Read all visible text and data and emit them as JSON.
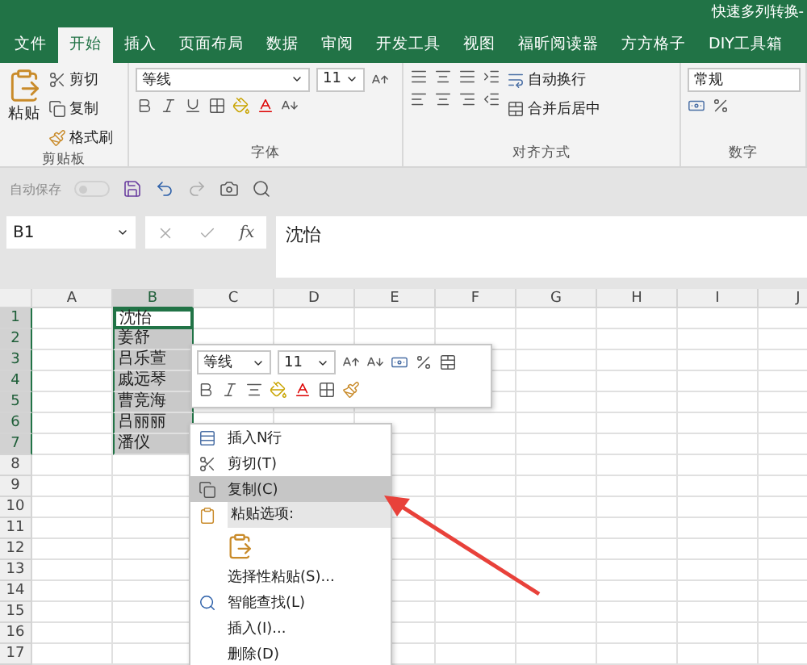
{
  "title_bar": {
    "title": "快速多列转换-"
  },
  "tabs": [
    {
      "label": "文件",
      "selected": false
    },
    {
      "label": "开始",
      "selected": true
    },
    {
      "label": "插入",
      "selected": false
    },
    {
      "label": "页面布局",
      "selected": false
    },
    {
      "label": "数据",
      "selected": false
    },
    {
      "label": "审阅",
      "selected": false
    },
    {
      "label": "开发工具",
      "selected": false
    },
    {
      "label": "视图",
      "selected": false
    },
    {
      "label": "福昕阅读器",
      "selected": false
    },
    {
      "label": "方方格子",
      "selected": false
    },
    {
      "label": "DIY工具箱",
      "selected": false
    }
  ],
  "ribbon": {
    "clipboard": {
      "label": "剪贴板",
      "paste": "粘贴",
      "cut": "剪切",
      "copy": "复制",
      "format_painter": "格式刷"
    },
    "font": {
      "label": "字体",
      "font_name": "等线",
      "font_size": "11"
    },
    "alignment": {
      "label": "对齐方式",
      "wrap_text": "自动换行",
      "merge": "合并后居中"
    },
    "number": {
      "label": "数字",
      "format": "常规"
    }
  },
  "quick_access": {
    "autosave_label": "自动保存",
    "autosave_on": false
  },
  "formula_bar": {
    "name_box": "B1",
    "function_label": "fx",
    "content": "沈怡"
  },
  "sheet": {
    "columns": [
      {
        "label": "A",
        "selected": false
      },
      {
        "label": "B",
        "selected": true
      },
      {
        "label": "C",
        "selected": false
      },
      {
        "label": "D",
        "selected": false
      },
      {
        "label": "E",
        "selected": false
      },
      {
        "label": "F",
        "selected": false
      },
      {
        "label": "G",
        "selected": false
      },
      {
        "label": "H",
        "selected": false
      },
      {
        "label": "I",
        "selected": false
      },
      {
        "label": "J",
        "selected": false
      }
    ],
    "rows": [
      {
        "header": "1",
        "b": "沈怡",
        "selected": true,
        "active": true
      },
      {
        "header": "2",
        "b": "姜舒",
        "selected": true,
        "active": false
      },
      {
        "header": "3",
        "b": "吕乐萱",
        "selected": true,
        "active": false
      },
      {
        "header": "4",
        "b": "戚远琴",
        "selected": true,
        "active": false
      },
      {
        "header": "5",
        "b": "曹竞海",
        "selected": true,
        "active": false
      },
      {
        "header": "6",
        "b": "吕丽丽",
        "selected": true,
        "active": false
      },
      {
        "header": "7",
        "b": "潘仪",
        "selected": true,
        "active": false
      },
      {
        "header": "8",
        "selected": false
      },
      {
        "header": "9",
        "selected": false
      },
      {
        "header": "10",
        "selected": false
      },
      {
        "header": "11",
        "selected": false
      },
      {
        "header": "12",
        "selected": false
      },
      {
        "header": "13",
        "selected": false
      },
      {
        "header": "14",
        "selected": false
      },
      {
        "header": "15",
        "selected": false
      },
      {
        "header": "16",
        "selected": false
      },
      {
        "header": "17",
        "selected": false
      }
    ]
  },
  "mini_toolbar": {
    "font_name": "等线",
    "font_size": "11"
  },
  "context_menu": {
    "items": [
      {
        "kind": "item",
        "label": "插入N行",
        "selected": false
      },
      {
        "kind": "item",
        "label": "剪切(T)",
        "selected": false
      },
      {
        "kind": "item",
        "label": "复制(C)",
        "selected": true
      },
      {
        "kind": "header",
        "label": "粘贴选项:"
      },
      {
        "kind": "paste_options"
      },
      {
        "kind": "item",
        "label": "选择性粘贴(S)...",
        "selected": false
      },
      {
        "kind": "item",
        "label": "智能查找(L)",
        "selected": false
      },
      {
        "kind": "item",
        "label": "插入(I)...",
        "selected": false
      },
      {
        "kind": "item",
        "label": "删除(D)",
        "selected": false
      }
    ]
  }
}
